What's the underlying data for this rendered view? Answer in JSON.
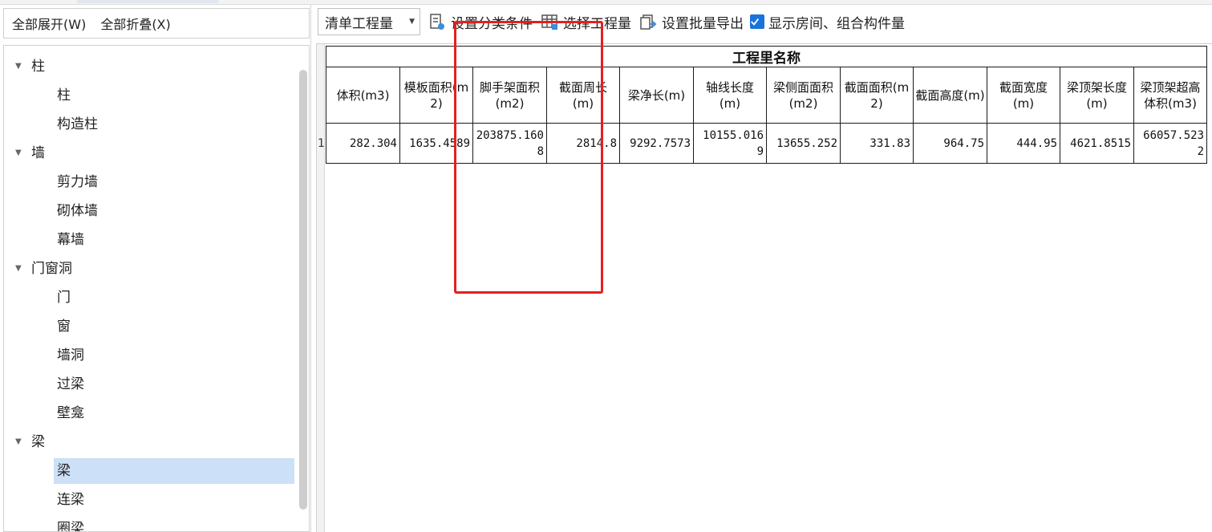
{
  "left_toolbar": {
    "expand_all": "全部展开(W)",
    "collapse_all": "全部折叠(X)"
  },
  "tree": {
    "groups": [
      {
        "label": "柱",
        "children": [
          "柱",
          "构造柱"
        ]
      },
      {
        "label": "墙",
        "children": [
          "剪力墙",
          "砌体墙",
          "幕墙"
        ]
      },
      {
        "label": "门窗洞",
        "children": [
          "门",
          "窗",
          "墙洞",
          "过梁",
          "壁龛"
        ]
      },
      {
        "label": "梁",
        "children": [
          "梁",
          "连梁",
          "圈梁"
        ]
      }
    ],
    "selected": "梁"
  },
  "right_toolbar": {
    "qty_type": "清单工程量",
    "set_category": "设置分类条件",
    "select_qty": "选择工程量",
    "batch_export": "设置批量导出",
    "show_rooms": "显示房间、组合构件量",
    "show_rooms_checked": true
  },
  "grid": {
    "title": "工程里名称",
    "columns": [
      "体积(m3)",
      "模板面积(m2)",
      "脚手架面积(m2)",
      "截面周长(m)",
      "梁净长(m)",
      "轴线长度(m)",
      "梁侧面面积(m2)",
      "截面面积(m2)",
      "截面高度(m)",
      "截面宽度(m)",
      "梁顶架长度(m)",
      "梁顶架超高体积(m3)"
    ],
    "row_number": "1",
    "rows": [
      [
        "282.304",
        "1635.4589",
        "203875.1608",
        "2814.8",
        "9292.7573",
        "10155.0169",
        "13655.252",
        "331.83",
        "964.75",
        "444.95",
        "4621.8515",
        "66057.5232"
      ]
    ]
  },
  "colors": {
    "selected_bg": "#cce0f7",
    "annotation": "#e32020",
    "checkbox": "#1a73d9"
  }
}
